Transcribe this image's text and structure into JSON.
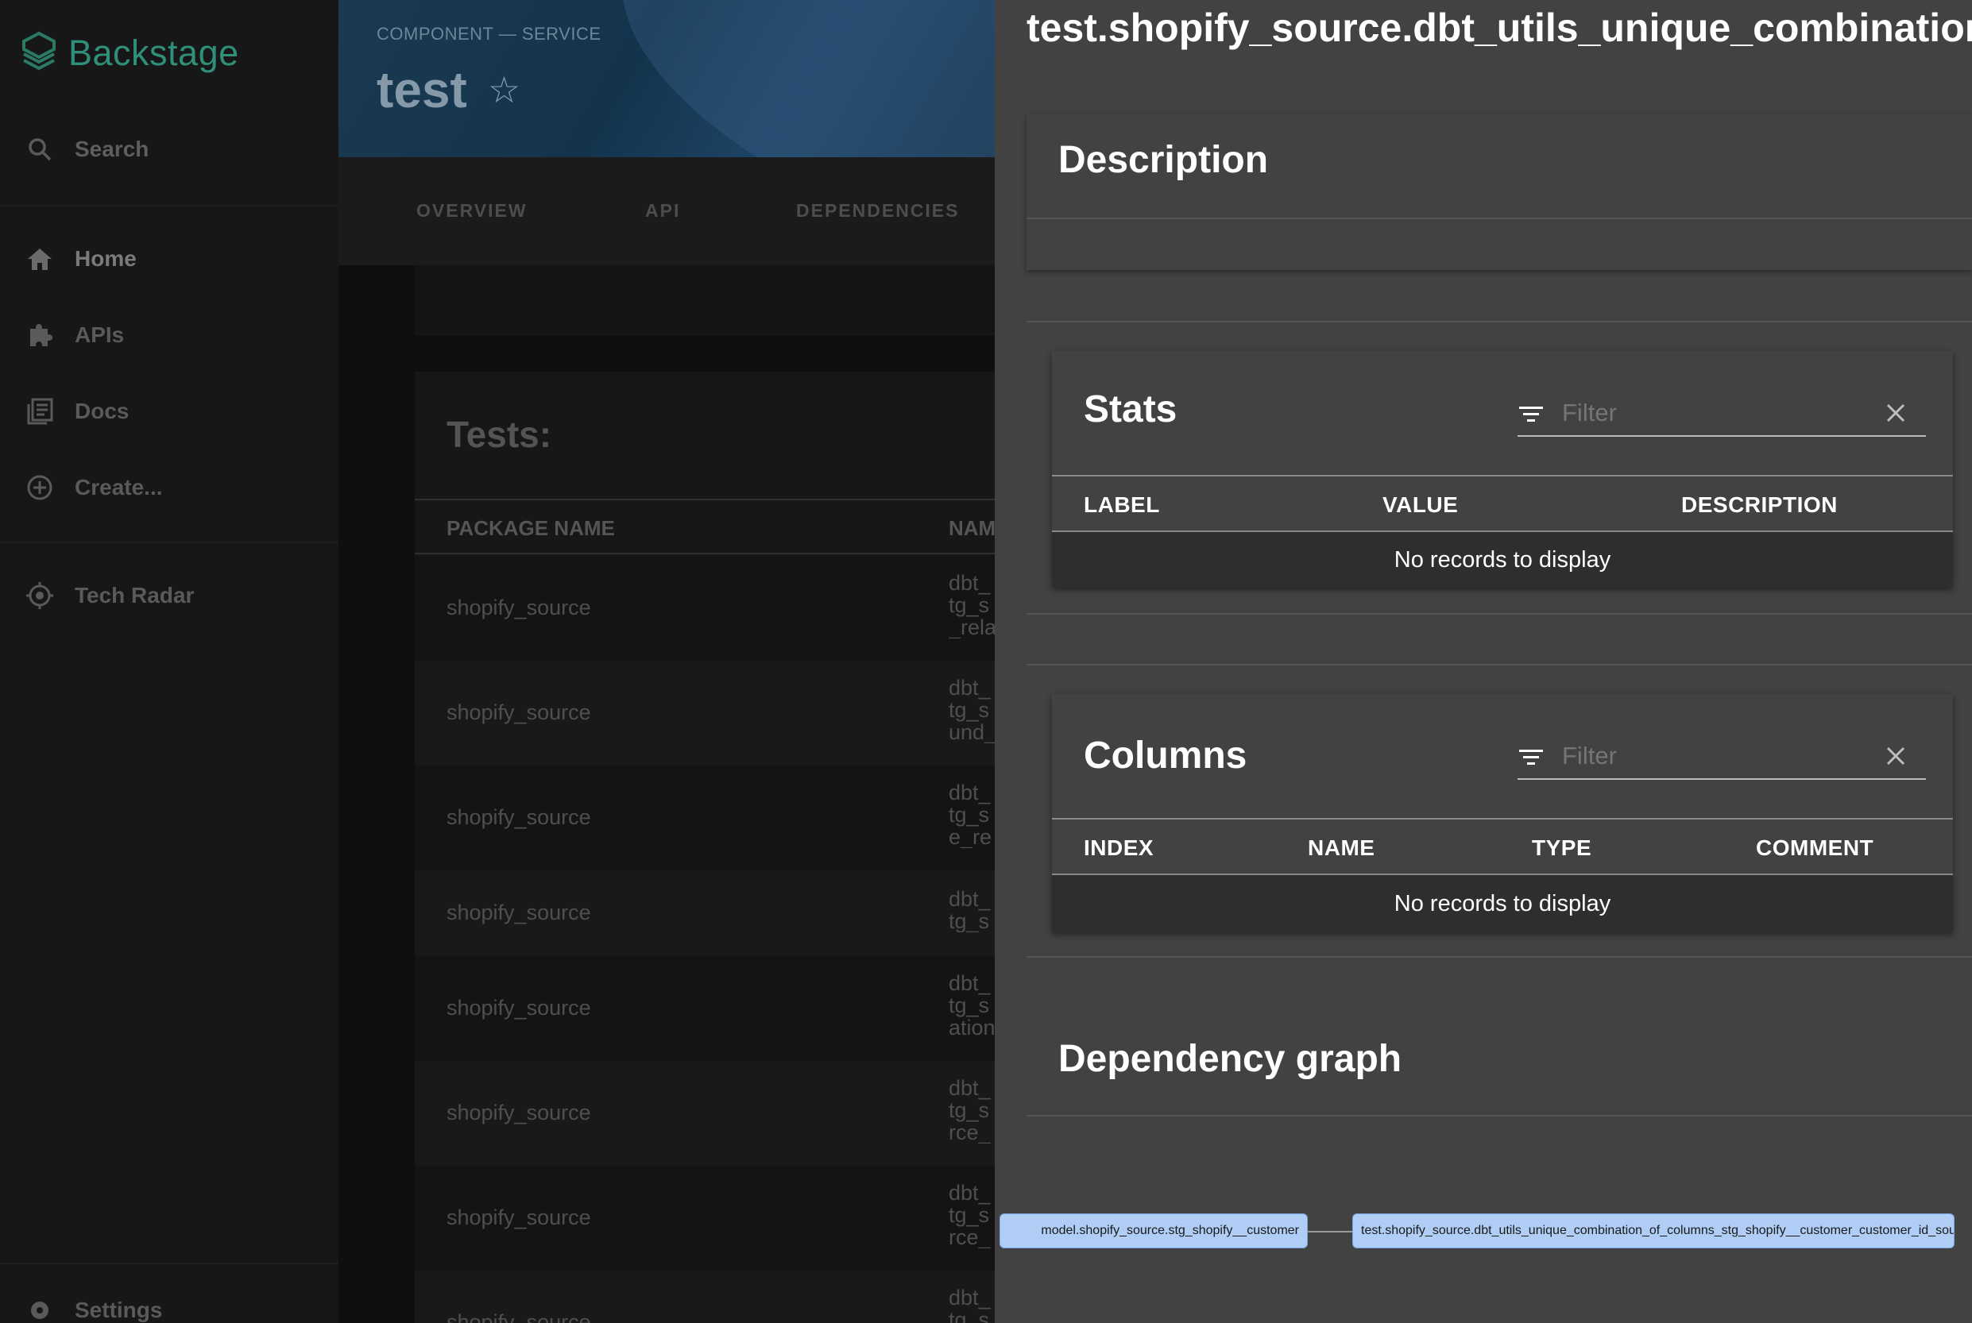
{
  "sidebar": {
    "brand": "Backstage",
    "search_label": "Search",
    "items": [
      {
        "label": "Home",
        "icon": "home-icon"
      },
      {
        "label": "APIs",
        "icon": "puzzle-icon"
      },
      {
        "label": "Docs",
        "icon": "docs-icon"
      },
      {
        "label": "Create...",
        "icon": "add-circle-icon"
      },
      {
        "label": "Tech Radar",
        "icon": "radar-icon"
      }
    ],
    "settings_label": "Settings"
  },
  "header": {
    "kind": "COMPONENT — SERVICE",
    "title": "test"
  },
  "tabs": [
    "OVERVIEW",
    "API",
    "DEPENDENCIES"
  ],
  "tests_table": {
    "title": "Tests:",
    "columns": [
      "PACKAGE NAME",
      "NAM"
    ],
    "rows": [
      {
        "package": "shopify_source",
        "name": "dbt_\ntg_s\n_rela"
      },
      {
        "package": "shopify_source",
        "name": "dbt_\ntg_s\nund_"
      },
      {
        "package": "shopify_source",
        "name": "dbt_\ntg_s\ne_re"
      },
      {
        "package": "shopify_source",
        "name": "dbt_\ntg_s"
      },
      {
        "package": "shopify_source",
        "name": "dbt_\ntg_s\nation"
      },
      {
        "package": "shopify_source",
        "name": "dbt_\ntg_s\nrce_"
      },
      {
        "package": "shopify_source",
        "name": "dbt_\ntg_s\nrce_"
      },
      {
        "package": "shopify_source",
        "name": "dbt_\ntg_s"
      }
    ]
  },
  "drawer": {
    "title": "test.shopify_source.dbt_utils_unique_combination_o",
    "description": {
      "title": "Description"
    },
    "stats": {
      "title": "Stats",
      "filter_placeholder": "Filter",
      "columns": [
        "LABEL",
        "VALUE",
        "DESCRIPTION"
      ],
      "empty": "No records to display"
    },
    "columns_table": {
      "title": "Columns",
      "filter_placeholder": "Filter",
      "columns": [
        "INDEX",
        "NAME",
        "TYPE",
        "COMMENT"
      ],
      "empty": "No records to display"
    },
    "graph": {
      "title": "Dependency graph",
      "nodes": [
        "model.shopify_source.stg_shopify__customer",
        "test.shopify_source.dbt_utils_unique_combination_of_columns_stg_shopify__customer_customer_id_source_relation"
      ]
    }
  },
  "colors": {
    "drawer_bg": "#424242",
    "node_fill": "#b0cdf5",
    "brand": "#1f5c4e"
  }
}
